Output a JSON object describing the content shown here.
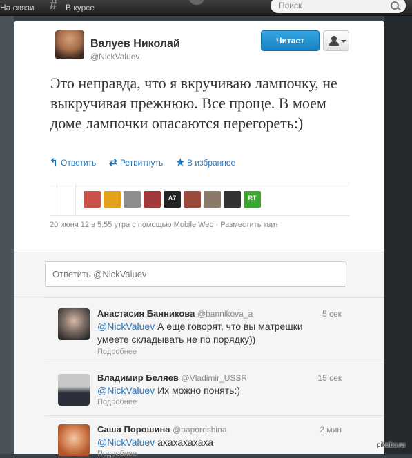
{
  "topbar": {
    "connect_label": "На связи",
    "discover_label": "В курсе",
    "search_placeholder": "Поиск"
  },
  "tweet": {
    "user_name": "Валуев Николай",
    "user_handle": "@NickValuev",
    "follow_label": "Читает",
    "text": "Это неправда, что я вкручиваю лампочку, не выкручивая прежнюю. Все проще. В моем доме лампочки опасаются перегореть:)",
    "actions": {
      "reply": "Ответить",
      "retweet": "Ретвитнуть",
      "favorite": "В избранное"
    },
    "favorited_avatars": [
      {
        "label": "",
        "color": "#c9524a"
      },
      {
        "label": "",
        "color": "#e3a21a"
      },
      {
        "label": "",
        "color": "#8e8e8e"
      },
      {
        "label": "",
        "color": "#a33a3a"
      },
      {
        "label": "A7",
        "color": "#222222"
      },
      {
        "label": "",
        "color": "#9a4a3a"
      },
      {
        "label": "",
        "color": "#8a7a6a"
      },
      {
        "label": "",
        "color": "#333333"
      },
      {
        "label": "RT",
        "color": "#3ca52f"
      }
    ],
    "meta": "20 июня 12 в 5:55 утра с помощью Mobile Web · Разместить твит"
  },
  "reply_box": {
    "placeholder": "Ответить @NickValuev"
  },
  "replies": [
    {
      "name": "Анастасия Банникова",
      "handle": "@bannikova_a",
      "time": "5 сек",
      "mention": "@NickValuev",
      "text": " А еще говорят, что вы матрешки умеете складывать не по порядку))",
      "more": "Подробнее",
      "avatar_color": "#6b6b6b"
    },
    {
      "name": "Владимир Беляев",
      "handle": "@Vladimir_USSR",
      "time": "15 сек",
      "mention": "@NickValuev",
      "text": " Их можно понять:)",
      "more": "Подробнее",
      "avatar_color": "#3a3f4a"
    },
    {
      "name": "Саша Порошина",
      "handle": "@aaporoshina",
      "time": "2 мин",
      "mention": "@NickValuev",
      "text": " ахахахахаха",
      "more": "Подробнее",
      "avatar_color": "#c46a3a"
    }
  ],
  "watermark": "pikabu.ru"
}
